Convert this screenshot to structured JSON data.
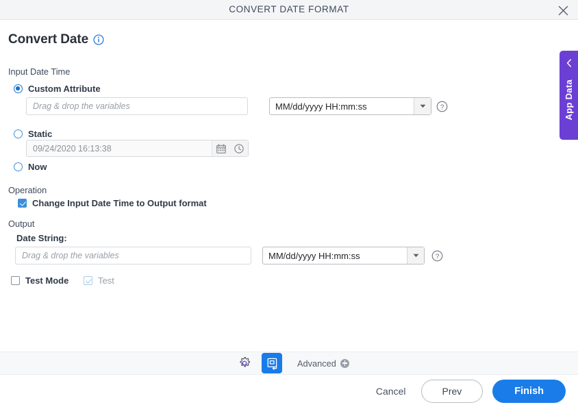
{
  "titlebar": {
    "title": "CONVERT DATE FORMAT",
    "close_icon": "close-icon"
  },
  "page": {
    "heading": "Convert Date",
    "info_icon": "info-icon"
  },
  "input_section": {
    "label": "Input Date Time",
    "options": [
      {
        "label": "Custom Attribute",
        "selected": true
      },
      {
        "label": "Static",
        "selected": false
      },
      {
        "label": "Now",
        "selected": false
      }
    ],
    "custom_attribute_field": {
      "value": "",
      "placeholder": "Drag & drop the variables"
    },
    "input_format_select": {
      "value": "MM/dd/yyyy HH:mm:ss",
      "arrow_icon": "chevron-down-icon",
      "help_icon": "question-circle-icon"
    },
    "static_field": {
      "value": "09/24/2020 16:13:38",
      "calendar_icon": "calendar-icon",
      "clock_icon": "clock-icon"
    }
  },
  "operation_section": {
    "label": "Operation",
    "checkbox": {
      "label": "Change Input Date Time to Output format",
      "checked": true
    }
  },
  "output_section": {
    "label": "Output",
    "field_label": "Date String:",
    "date_string_field": {
      "value": "",
      "placeholder": "Drag & drop the variables"
    },
    "output_format_select": {
      "value": "MM/dd/yyyy HH:mm:ss",
      "arrow_icon": "chevron-down-icon",
      "help_icon": "question-circle-icon"
    }
  },
  "test_row": {
    "test_mode": {
      "label": "Test Mode",
      "checked": false
    },
    "test": {
      "label": "Test",
      "checked": true,
      "disabled": true
    }
  },
  "app_data_tab": {
    "label": "App Data",
    "chevron_icon": "chevron-left-icon"
  },
  "toolbar": {
    "gear_icon": "gear-icon",
    "convert_icon": "convert-date-icon",
    "advanced_label": "Advanced",
    "advanced_plus_icon": "plus-circle-icon"
  },
  "footer": {
    "cancel_label": "Cancel",
    "prev_label": "Prev",
    "finish_label": "Finish"
  },
  "colors": {
    "accent_blue": "#1a7ce8",
    "purple": "#6b3fd4",
    "titlebar_bg": "#f4f5f7",
    "toolbar_bg": "#f7f8f9",
    "text_dark": "#2f3a47"
  }
}
